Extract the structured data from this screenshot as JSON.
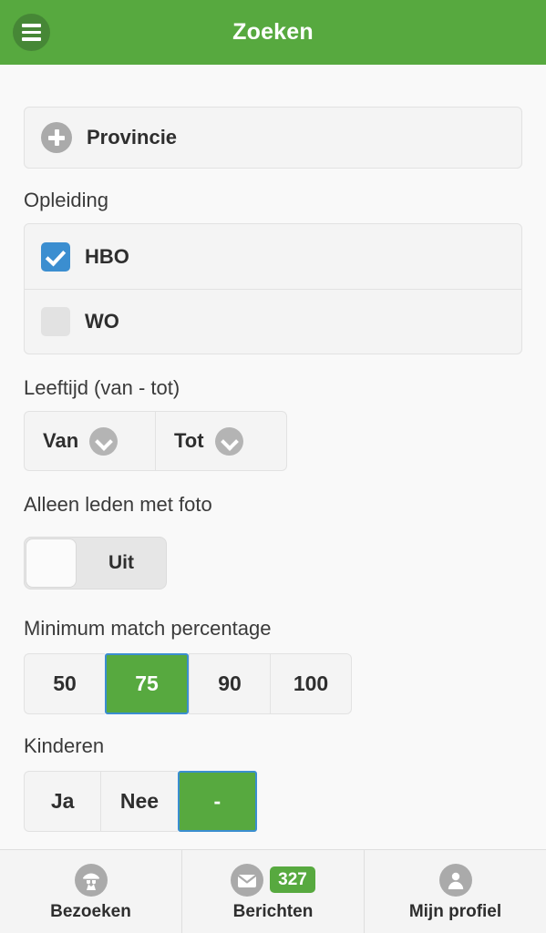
{
  "header": {
    "title": "Zoeken",
    "menu_icon": "hamburger-menu-icon",
    "background_color": "#57a93f",
    "menu_button_color": "#468736"
  },
  "filters": {
    "provincie": {
      "label": "Provincie",
      "icon": "plus-circle-icon"
    },
    "opleiding": {
      "label": "Opleiding",
      "options": [
        {
          "label": "HBO",
          "checked": true
        },
        {
          "label": "WO",
          "checked": false
        }
      ],
      "checked_color": "#3b8ed0"
    },
    "leeftijd": {
      "label": "Leeftijd (van - tot)",
      "from": {
        "label": "Van",
        "icon": "chevron-down-icon"
      },
      "to": {
        "label": "Tot",
        "icon": "chevron-down-icon"
      }
    },
    "foto": {
      "label": "Alleen leden met foto",
      "toggle_state": "Uit"
    },
    "match": {
      "label": "Minimum match percentage",
      "options": [
        "50",
        "75",
        "90",
        "100"
      ],
      "selected": "75",
      "selected_color": "#57a93f",
      "focus_color": "#3b8ed0"
    },
    "kinderen": {
      "label": "Kinderen",
      "options": [
        "Ja",
        "Nee",
        "-"
      ],
      "selected": "-"
    }
  },
  "bottom_nav": {
    "items": [
      {
        "label": "Bezoeken",
        "icon": "spy-detective-icon",
        "badge": ""
      },
      {
        "label": "Berichten",
        "icon": "envelope-icon",
        "badge": "327"
      },
      {
        "label": "Mijn profiel",
        "icon": "person-icon",
        "badge": ""
      }
    ],
    "badge_color": "#57a93f"
  }
}
